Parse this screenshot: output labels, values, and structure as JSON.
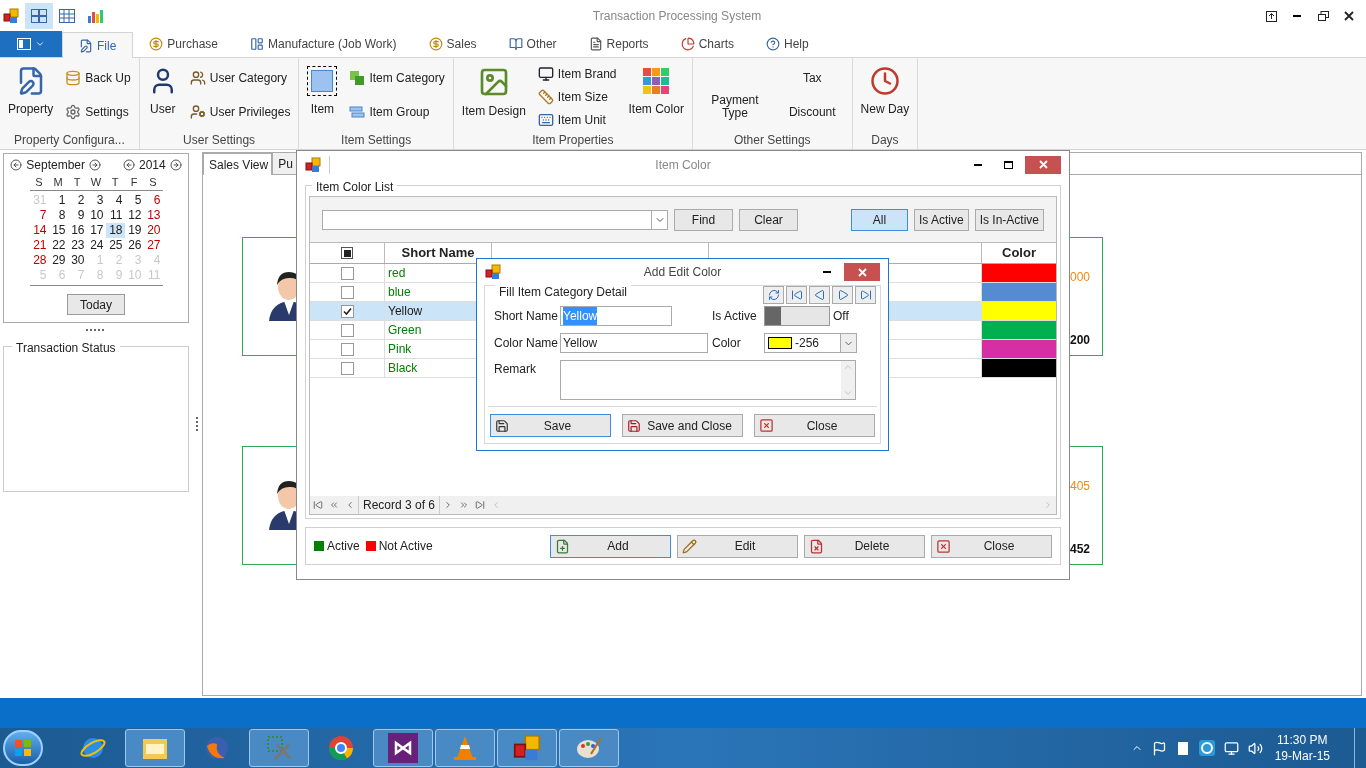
{
  "app": {
    "title": "Transaction Processing System"
  },
  "quick_access": [
    {
      "selected": true
    },
    {
      "selected": false
    },
    {
      "selected": false
    }
  ],
  "ribbon": {
    "tabs": [
      {
        "label": "File",
        "selected": true
      },
      {
        "label": "Purchase",
        "selected": false
      },
      {
        "label": "Manufacture (Job Work)",
        "selected": false
      },
      {
        "label": "Sales",
        "selected": false
      },
      {
        "label": "Other",
        "selected": false
      },
      {
        "label": "Reports",
        "selected": false
      },
      {
        "label": "Charts",
        "selected": false
      },
      {
        "label": "Help",
        "selected": false
      }
    ],
    "groups": [
      {
        "title": "Property Configura...",
        "columns": [
          [
            {
              "label": "Property",
              "kind": "large"
            }
          ],
          [
            {
              "label": "Back Up",
              "kind": "small"
            },
            {
              "label": "Settings",
              "kind": "small"
            }
          ]
        ]
      },
      {
        "title": "User Settings",
        "columns": [
          [
            {
              "label": "User",
              "kind": "large"
            }
          ],
          [
            {
              "label": "User Category",
              "kind": "small"
            },
            {
              "label": "User Privileges",
              "kind": "small"
            }
          ]
        ]
      },
      {
        "title": "Item Settings",
        "columns": [
          [
            {
              "label": "Item",
              "kind": "large"
            }
          ],
          [
            {
              "label": "Item Category",
              "kind": "small"
            },
            {
              "label": "Item Group",
              "kind": "small"
            }
          ]
        ]
      },
      {
        "title": "Item Properties",
        "columns": [
          [
            {
              "label": "Item Design",
              "kind": "large"
            }
          ],
          [
            {
              "label": "Item Brand",
              "kind": "small"
            },
            {
              "label": "Item Size",
              "kind": "small"
            },
            {
              "label": "Item Unit",
              "kind": "small"
            }
          ],
          [
            {
              "label": "Item Color",
              "kind": "large"
            }
          ]
        ]
      },
      {
        "title": "Other Settings",
        "columns": [
          [
            {
              "label": "Payment Type",
              "kind": "plain"
            }
          ],
          [
            {
              "label": "Tax",
              "kind": "plain"
            },
            {
              "label": "Discount",
              "kind": "plain"
            }
          ]
        ]
      },
      {
        "title": "Days",
        "columns": [
          [
            {
              "label": "New Day",
              "kind": "large"
            }
          ]
        ]
      }
    ]
  },
  "calendar": {
    "month": "September",
    "year": "2014",
    "weekdays": [
      "S",
      "M",
      "T",
      "W",
      "T",
      "F",
      "S"
    ],
    "days": [
      {
        "text": "31",
        "kind": "muted",
        "selected": false
      },
      {
        "text": "1",
        "kind": "normal",
        "selected": false
      },
      {
        "text": "2",
        "kind": "normal",
        "selected": false
      },
      {
        "text": "3",
        "kind": "normal",
        "selected": false
      },
      {
        "text": "4",
        "kind": "normal",
        "selected": false
      },
      {
        "text": "5",
        "kind": "normal",
        "selected": false
      },
      {
        "text": "6",
        "kind": "weekend",
        "selected": false
      },
      {
        "text": "7",
        "kind": "weekend",
        "selected": false
      },
      {
        "text": "8",
        "kind": "normal",
        "selected": false
      },
      {
        "text": "9",
        "kind": "normal",
        "selected": false
      },
      {
        "text": "10",
        "kind": "normal",
        "selected": false
      },
      {
        "text": "11",
        "kind": "normal",
        "selected": false
      },
      {
        "text": "12",
        "kind": "normal",
        "selected": false
      },
      {
        "text": "13",
        "kind": "weekend",
        "selected": false
      },
      {
        "text": "14",
        "kind": "weekend",
        "selected": false
      },
      {
        "text": "15",
        "kind": "normal",
        "selected": false
      },
      {
        "text": "16",
        "kind": "normal",
        "selected": false
      },
      {
        "text": "17",
        "kind": "normal",
        "selected": false
      },
      {
        "text": "18",
        "kind": "normal",
        "selected": true
      },
      {
        "text": "19",
        "kind": "normal",
        "selected": false
      },
      {
        "text": "20",
        "kind": "weekend",
        "selected": false
      },
      {
        "text": "21",
        "kind": "weekend",
        "selected": false
      },
      {
        "text": "22",
        "kind": "normal",
        "selected": false
      },
      {
        "text": "23",
        "kind": "normal",
        "selected": false
      },
      {
        "text": "24",
        "kind": "normal",
        "selected": false
      },
      {
        "text": "25",
        "kind": "normal",
        "selected": false
      },
      {
        "text": "26",
        "kind": "normal",
        "selected": false
      },
      {
        "text": "27",
        "kind": "weekend",
        "selected": false
      },
      {
        "text": "28",
        "kind": "weekend",
        "selected": false
      },
      {
        "text": "29",
        "kind": "normal",
        "selected": false
      },
      {
        "text": "30",
        "kind": "normal",
        "selected": false
      },
      {
        "text": "1",
        "kind": "muted",
        "selected": false
      },
      {
        "text": "2",
        "kind": "muted",
        "selected": false
      },
      {
        "text": "3",
        "kind": "muted",
        "selected": false
      },
      {
        "text": "4",
        "kind": "muted",
        "selected": false
      },
      {
        "text": "5",
        "kind": "muted",
        "selected": false
      },
      {
        "text": "6",
        "kind": "muted",
        "selected": false
      },
      {
        "text": "7",
        "kind": "muted",
        "selected": false
      },
      {
        "text": "8",
        "kind": "muted",
        "selected": false
      },
      {
        "text": "9",
        "kind": "muted",
        "selected": false
      },
      {
        "text": "10",
        "kind": "muted",
        "selected": false
      },
      {
        "text": "11",
        "kind": "muted",
        "selected": false
      }
    ],
    "today_button": "Today"
  },
  "transaction_status": {
    "title": "Transaction Status"
  },
  "main_tabs": [
    {
      "label": "Sales View",
      "selected": true
    },
    {
      "label": "Pu",
      "selected": false
    }
  ],
  "cards": [
    {
      "top_value": "000",
      "bottom_value": "200"
    },
    {
      "top_value": "405",
      "bottom_value": "452"
    }
  ],
  "item_color_window": {
    "title": "Item Color",
    "group_title": "Item Color List",
    "find_button": "Find",
    "clear_button": "Clear",
    "filters": [
      {
        "label": "All",
        "selected": true
      },
      {
        "label": "Is Active",
        "selected": false
      },
      {
        "label": "Is In-Active",
        "selected": false
      }
    ],
    "select_all_partial": true,
    "column_headers": {
      "short_name": "Short Name",
      "swatch_column": "Color"
    },
    "rows": [
      {
        "short_name": "red",
        "color": "#ff0000",
        "checked": false,
        "selected": false,
        "active": true
      },
      {
        "short_name": "blue",
        "color": "#568bd4",
        "checked": false,
        "selected": false,
        "active": true
      },
      {
        "short_name": "Yellow",
        "color": "#ffff00",
        "checked": true,
        "selected": true,
        "active": true
      },
      {
        "short_name": "Green",
        "color": "#00b050",
        "checked": false,
        "selected": false,
        "active": true
      },
      {
        "short_name": "Pink",
        "color": "#d62ea3",
        "checked": false,
        "selected": false,
        "active": true
      },
      {
        "short_name": "Black",
        "color": "#000000",
        "checked": false,
        "selected": false,
        "active": true
      }
    ],
    "record_text": "Record 3 of 6",
    "legend": [
      {
        "label": "Active",
        "color": "#008000"
      },
      {
        "label": "Not Active",
        "color": "#ff0000"
      }
    ],
    "buttons": [
      {
        "label": "Add",
        "focused": true
      },
      {
        "label": "Edit",
        "focused": false
      },
      {
        "label": "Delete",
        "focused": false
      },
      {
        "label": "Close",
        "focused": false
      }
    ]
  },
  "add_edit_dialog": {
    "title": "Add Edit Color",
    "group_title": "Fill Item Category Detail",
    "short_name": {
      "label": "Short Name",
      "value": "Yellow",
      "text_selected": true
    },
    "is_active": {
      "label": "Is Active",
      "on": false,
      "state_text": "Off"
    },
    "color_name": {
      "label": "Color Name",
      "value": "Yellow"
    },
    "color": {
      "label": "Color",
      "color": "#ffff00",
      "value": "-256"
    },
    "remark": {
      "label": "Remark"
    },
    "buttons": [
      {
        "label": "Save",
        "focused": true
      },
      {
        "label": "Save and Close",
        "focused": false
      },
      {
        "label": "Close",
        "focused": false
      }
    ]
  },
  "taskbar": {
    "apps": [
      {
        "running": false
      },
      {
        "running": true
      },
      {
        "running": false
      },
      {
        "running": true
      },
      {
        "running": false
      },
      {
        "running": true
      },
      {
        "running": true
      },
      {
        "running": true
      },
      {
        "running": true
      }
    ],
    "clock": {
      "time": "11:30 PM",
      "date": "19-Mar-15"
    }
  }
}
